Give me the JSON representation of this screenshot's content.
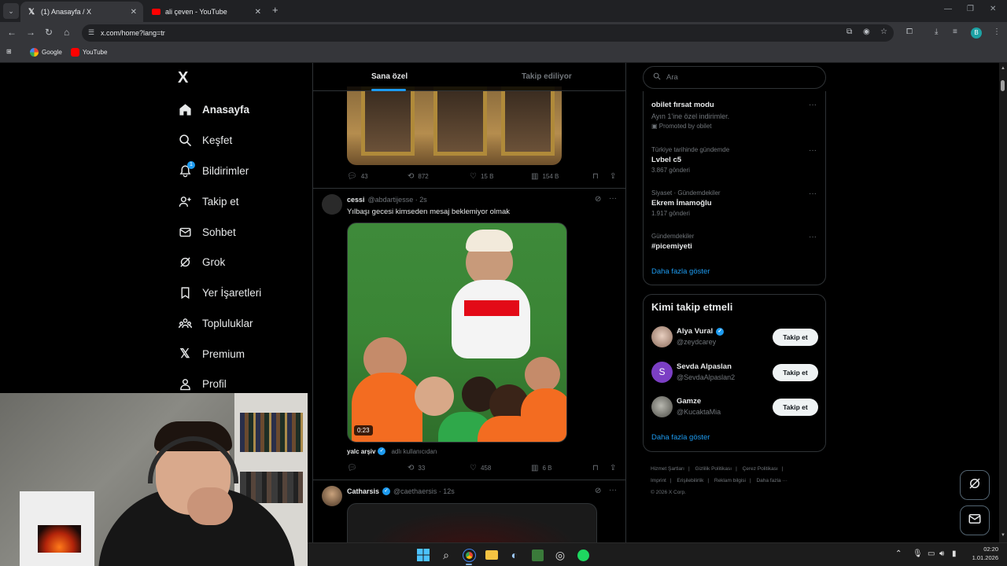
{
  "browser": {
    "tabs": [
      {
        "title": "(1) Anasayfa / X",
        "active": true
      },
      {
        "title": "ali çeven - YouTube",
        "active": false
      }
    ],
    "url": "x.com/home?lang=tr",
    "profile_initial": "B",
    "bookmarks": [
      {
        "label": "Google"
      },
      {
        "label": "YouTube"
      }
    ]
  },
  "nav": {
    "logo": "X",
    "notification_count": "1",
    "items": [
      {
        "label": "Anasayfa"
      },
      {
        "label": "Keşfet"
      },
      {
        "label": "Bildirimler"
      },
      {
        "label": "Takip et"
      },
      {
        "label": "Sohbet"
      },
      {
        "label": "Grok"
      },
      {
        "label": "Yer İşaretleri"
      },
      {
        "label": "Topluluklar"
      },
      {
        "label": "Premium"
      },
      {
        "label": "Profil"
      }
    ]
  },
  "feed": {
    "tabs": [
      {
        "label": "Sana özel",
        "active": true
      },
      {
        "label": "Takip ediliyor",
        "active": false
      }
    ],
    "tweets": [
      {
        "replies": "43",
        "retweets": "872",
        "likes": "15 B",
        "views": "154 B"
      },
      {
        "name": "cessi",
        "handle": "@abdartijesse",
        "time": "2s",
        "text": "Yılbaşı gecesi kimseden mesaj beklemiyor olmak",
        "video_duration": "0:23",
        "source_name": "yalc arşiv",
        "source_note": "adlı kullanıcıdan",
        "replies": "",
        "retweets": "33",
        "likes": "458",
        "views": "6 B"
      },
      {
        "name": "Catharsis",
        "handle": "@caethaersis",
        "time": "12s"
      }
    ]
  },
  "sidebar": {
    "search_placeholder": "Ara",
    "trends": [
      {
        "title": "obilet fırsat modu",
        "desc": "Ayın 1'ine özel indirimler.",
        "promoted": "Promoted by obilet"
      },
      {
        "context": "Türkiye tarihinde gündemde",
        "title": "Lvbel c5",
        "count": "3.867 gönderi"
      },
      {
        "context": "Siyaset · Gündemdekiler",
        "title": "Ekrem İmamoğlu",
        "count": "1.917 gönderi"
      },
      {
        "context": "Gündemdekiler",
        "title": "#picemiyeti"
      }
    ],
    "trends_more": "Daha fazla göster",
    "wtf_title": "Kimi takip etmeli",
    "who_to_follow": [
      {
        "name": "Alya Vural",
        "handle": "@zeydcarey",
        "verified": true,
        "button": "Takip et"
      },
      {
        "name": "Sevda Alpaslan",
        "handle": "@SevdaAlpaslan2",
        "verified": false,
        "avatar_letter": "S",
        "button": "Takip et"
      },
      {
        "name": "Gamze",
        "handle": "@KucaktaMia",
        "verified": false,
        "button": "Takip et"
      }
    ],
    "wtf_more": "Daha fazla göster",
    "footer": [
      "Hizmet Şartları",
      "|",
      "Gizlilik Politikası",
      "|",
      "Çerez Politikası",
      "|",
      "Imprint",
      "|",
      "Erişilebilirlik",
      "|",
      "Reklam bilgisi",
      "|",
      "Daha fazla ···",
      "© 2026 X Corp."
    ]
  },
  "taskbar": {
    "time": "02:20",
    "date": "1.01.2026"
  },
  "colors": {
    "accent": "#1d9bf0",
    "background": "#000000",
    "secondary_text": "#71767b",
    "border": "#2f3336"
  }
}
